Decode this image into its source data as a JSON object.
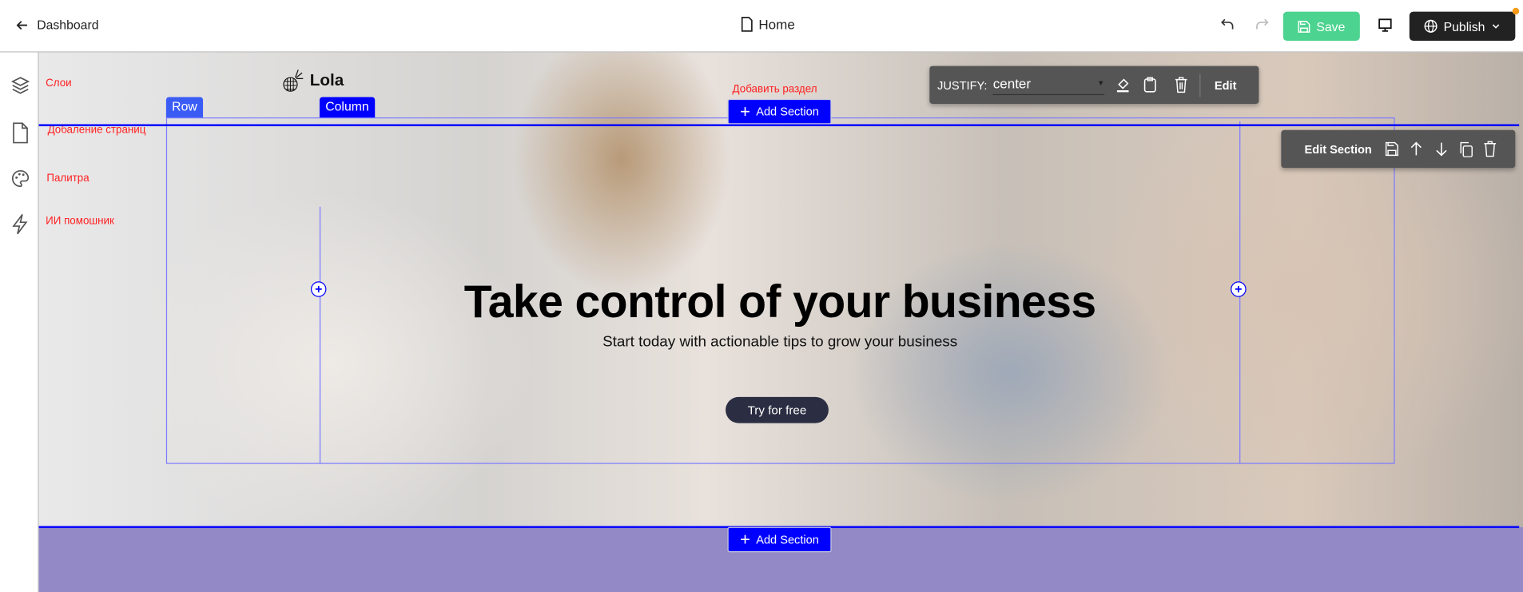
{
  "header": {
    "back_label": "Dashboard",
    "page_title": "Home",
    "save_label": "Save",
    "publish_label": "Publish"
  },
  "sidebar": {
    "items": [
      {
        "icon": "layers-icon",
        "label": "Слои"
      },
      {
        "icon": "file-icon",
        "label": "Добаление страниц"
      },
      {
        "icon": "palette-icon",
        "label": "Палитра"
      },
      {
        "icon": "lightning-icon",
        "label": "ИИ помошник"
      }
    ]
  },
  "canvas": {
    "logo_text": "Lola",
    "row_tag": "Row",
    "column_tag": "Column",
    "add_section_hint": "Добавить раздел",
    "add_section_label": "Add Section",
    "element_toolbar": {
      "justify_label": "JUSTIFY:",
      "justify_value": "center",
      "edit_label": "Edit"
    },
    "section_toolbar": {
      "edit_label": "Edit Section"
    },
    "hero": {
      "title": "Take control of your business",
      "subtitle": "Start today with actionable tips to grow your business",
      "cta": "Try for free"
    }
  },
  "colors": {
    "save": "#4cd38f",
    "publish": "#222222",
    "selection": "#0000ff",
    "lower_section": "#9289c6",
    "toolbar": "#555555",
    "cta": "#2b2d42"
  }
}
